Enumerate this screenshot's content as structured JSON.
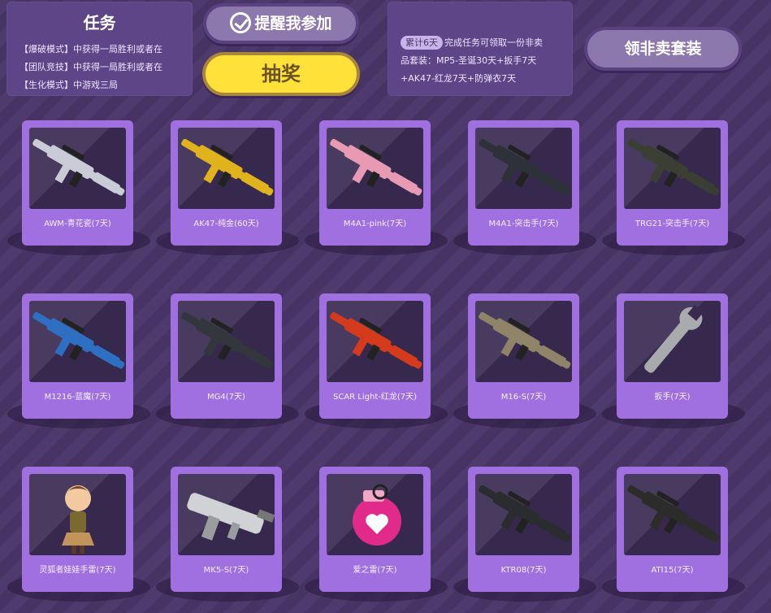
{
  "task_panel": {
    "title": "任务",
    "lines": [
      "【爆破模式】中获得一局胜利或者在",
      "【团队竞技】中获得一局胜利或者在",
      "【生化模式】中游戏三局"
    ]
  },
  "buttons": {
    "remind": "提醒我参加",
    "lottery": "抽奖",
    "claim_suit": "领非卖套装"
  },
  "info_panel": {
    "badge": "累计6天",
    "line1": "完成任务可领取一份非卖",
    "line2": "品套装：MP5-圣诞30天+扳手7天",
    "line3": "+AK47-红龙7天+防弹衣7天"
  },
  "colors": {
    "background": "#4a3568",
    "panel": "#5e4588",
    "card": "#a070e0",
    "lottery_button": "#ffe13a"
  },
  "items": [
    {
      "label": "AWM-青花瓷(7天)",
      "icon": "sniper-rifle-icon"
    },
    {
      "label": "AK47-纯金(60天)",
      "icon": "ak47-rifle-icon"
    },
    {
      "label": "M4A1-pink(7天)",
      "icon": "m4a1-rifle-icon"
    },
    {
      "label": "M4A1-突击手(7天)",
      "icon": "m4a1-rifle-icon"
    },
    {
      "label": "TRG21-突击手(7天)",
      "icon": "sniper-rifle-icon"
    },
    {
      "label": "M1216-蓝魔(7天)",
      "icon": "shotgun-icon"
    },
    {
      "label": "MG4(7天)",
      "icon": "machine-gun-icon"
    },
    {
      "label": "SCAR Light-红龙(7天)",
      "icon": "scar-rifle-icon"
    },
    {
      "label": "M16-S(7天)",
      "icon": "m16-rifle-icon"
    },
    {
      "label": "扳手(7天)",
      "icon": "wrench-icon"
    },
    {
      "label": "灵狐者娃娃手雷(7天)",
      "icon": "doll-grenade-icon"
    },
    {
      "label": "MK5-S(7天)",
      "icon": "smg-icon"
    },
    {
      "label": "爱之雷(7天)",
      "icon": "heart-grenade-icon"
    },
    {
      "label": "KTR08(7天)",
      "icon": "assault-rifle-icon"
    },
    {
      "label": "ATI15(7天)",
      "icon": "assault-rifle-icon"
    }
  ]
}
